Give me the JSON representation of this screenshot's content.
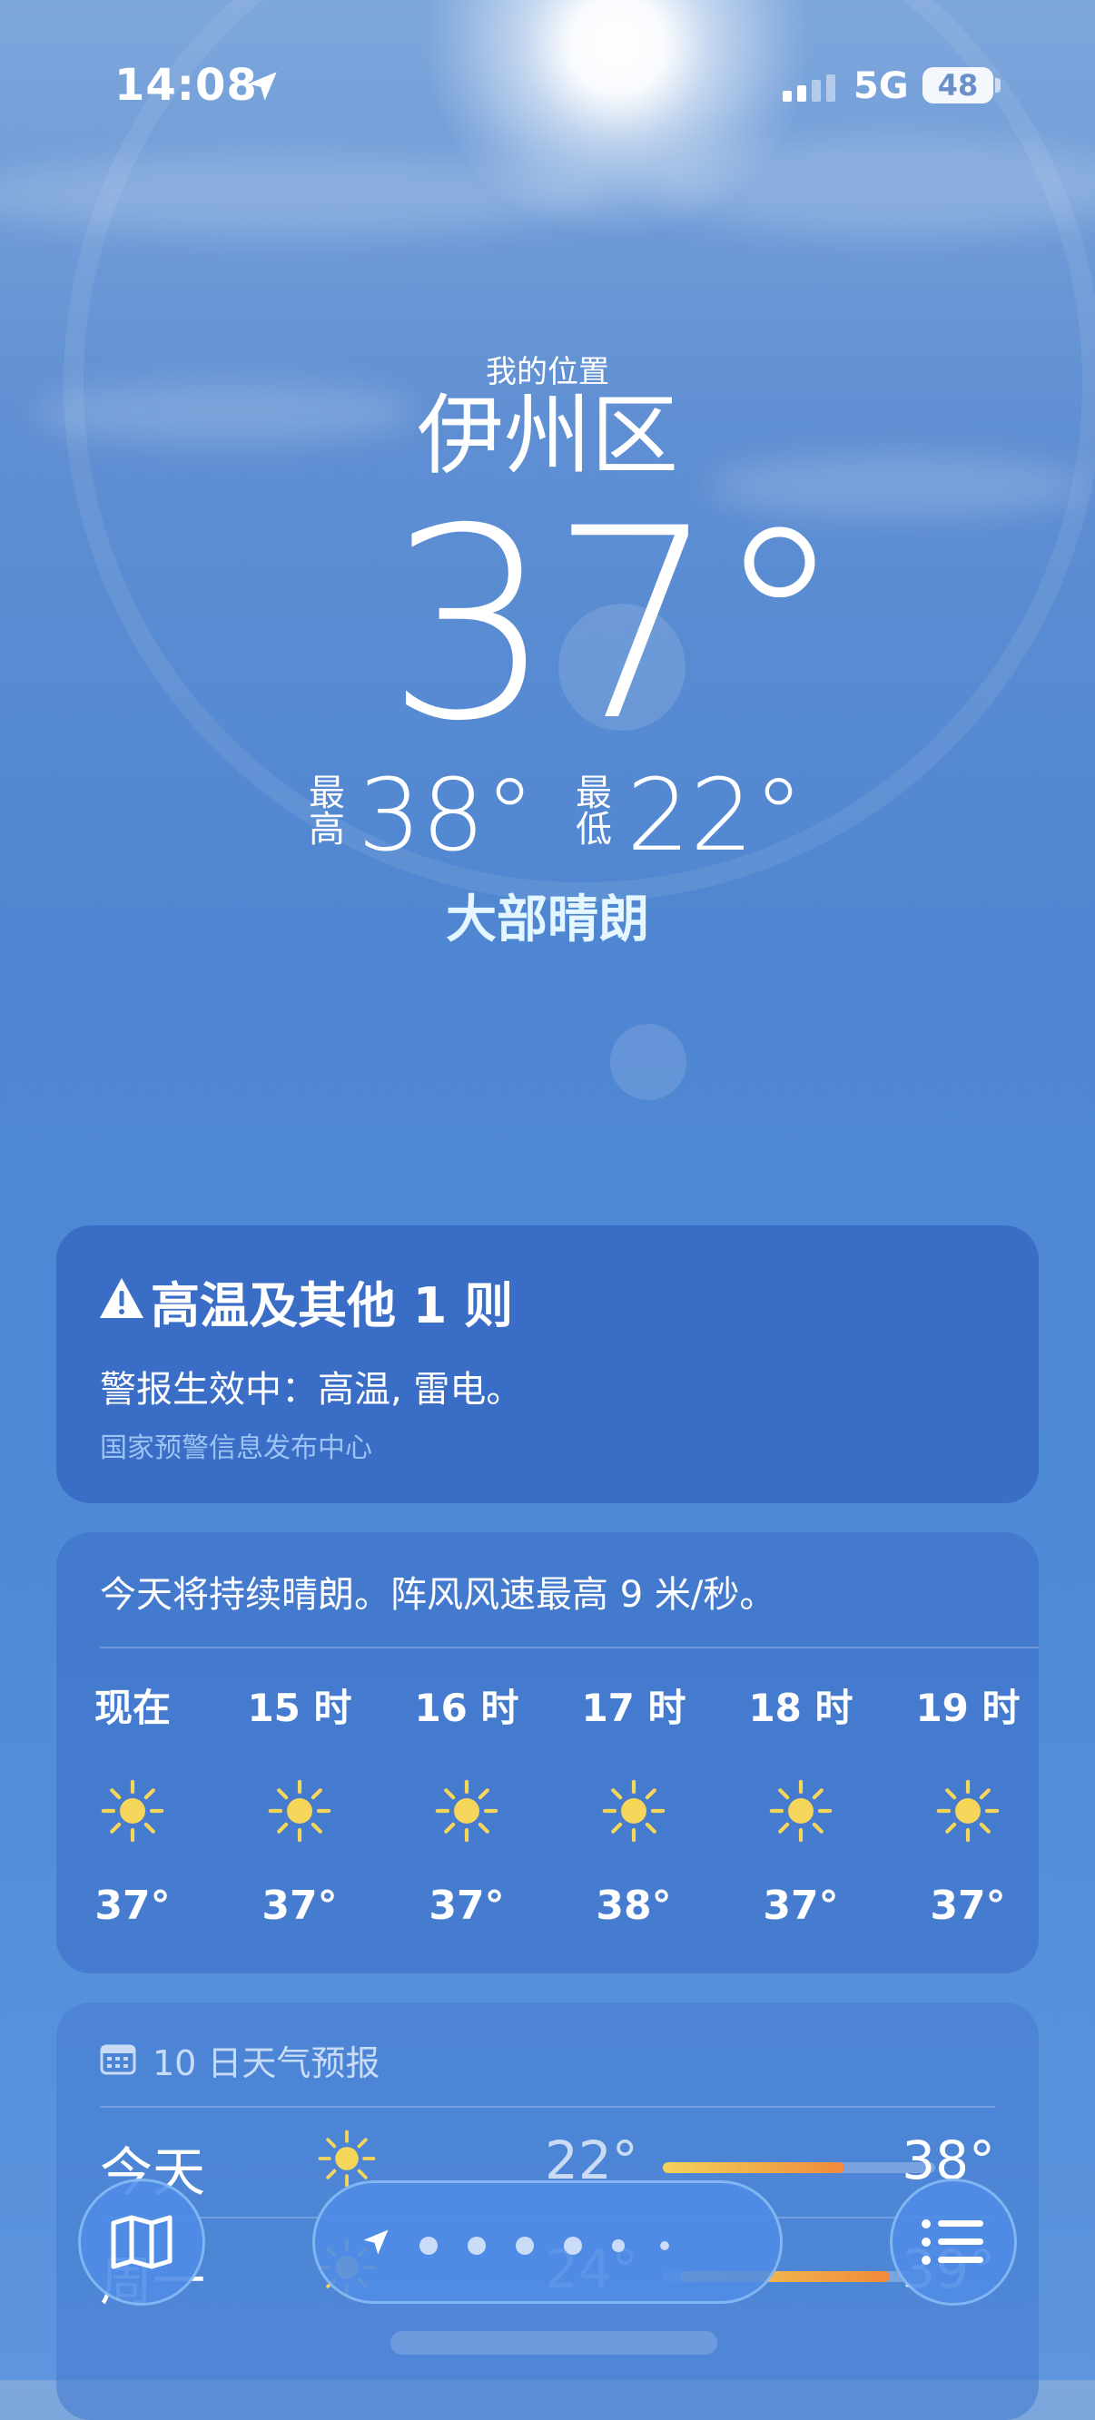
{
  "status_bar": {
    "time": "14:08",
    "network": "5G",
    "battery": "48"
  },
  "location": {
    "label": "我的位置",
    "city": "伊州区"
  },
  "current": {
    "temperature": "37°",
    "high_label": "最高",
    "high": "38°",
    "low_label": "最低",
    "low": "22°",
    "condition": "大部晴朗"
  },
  "alert": {
    "title": "高温及其他 1 则",
    "body": "警报生效中：高温, 雷电。",
    "source": "国家预警信息发布中心"
  },
  "hourly": {
    "summary": "今天将持续晴朗。阵风风速最高 9 米/秒。",
    "items": [
      {
        "time": "现在",
        "icon": "sun-icon",
        "temp": "37°"
      },
      {
        "time": "15 时",
        "icon": "sun-icon",
        "temp": "37°"
      },
      {
        "time": "16 时",
        "icon": "sun-icon",
        "temp": "37°"
      },
      {
        "time": "17 时",
        "icon": "sun-icon",
        "temp": "38°"
      },
      {
        "time": "18 时",
        "icon": "sun-icon",
        "temp": "37°"
      },
      {
        "time": "19 时",
        "icon": "sun-icon",
        "temp": "37°"
      }
    ]
  },
  "daily": {
    "title": "10 日天气预报",
    "rows": [
      {
        "day": "今天",
        "icon": "sun-icon",
        "low": "22°",
        "high": "38°"
      },
      {
        "day": "周一",
        "icon": "sun-icon",
        "low": "24°",
        "high": "39°"
      }
    ]
  },
  "toolbar": {
    "map": "map-icon",
    "location": "location-arrow-icon",
    "list": "list-icon",
    "pages": 7,
    "active_page": 0
  }
}
